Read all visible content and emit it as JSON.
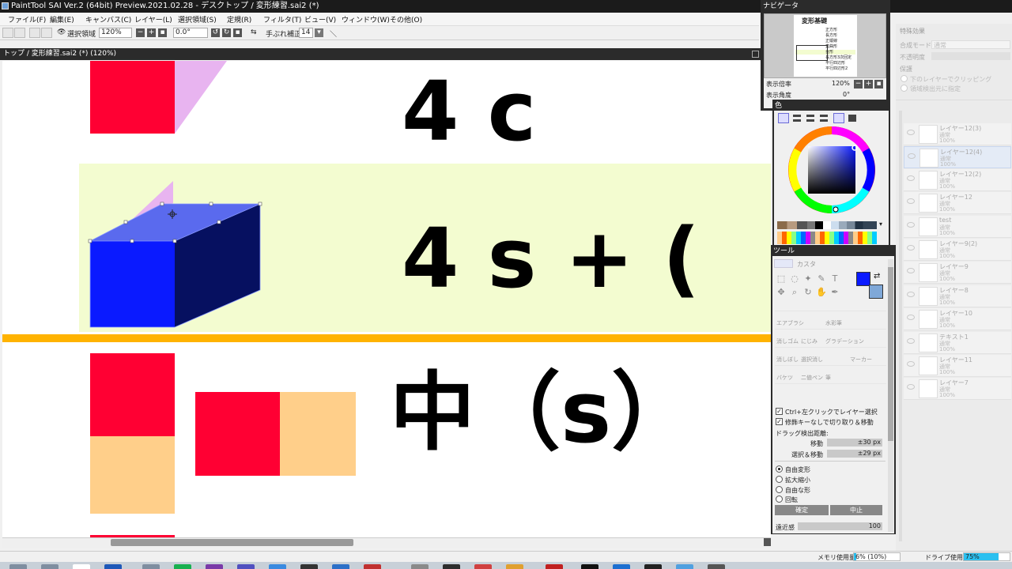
{
  "window": {
    "title": "PaintTool SAI Ver.2 (64bit) Preview.2021.02.28 - デスクトップ / 変形練習.sai2 (*)"
  },
  "menu": [
    "ファイル(F)",
    "編集(E)",
    "キャンバス(C)",
    "レイヤー(L)",
    "選択領域(S)",
    "定規(R)",
    "フィルタ(T)",
    "ビュー(V)",
    "ウィンドウ(W)",
    "その他(O)"
  ],
  "toolbar": {
    "selection_label": "選択領域",
    "zoom": "120%",
    "angle": "0.0°",
    "stabilizer_label": "手ぶれ補正",
    "stabilizer_value": "14"
  },
  "canvas": {
    "tab_title": "トップ / 変形練習.sai2 (*) (120%)",
    "text_4c": "4 c",
    "text_4s": "4 s + (",
    "text_naka": "中（s）",
    "colors": {
      "red": "#ff0033",
      "pink": "#e8b4f0",
      "blue": "#0a1aff",
      "navy": "#061060",
      "selection_blue": "#5a6aee",
      "yellow_band": "#f3fcd0",
      "orange_line": "#ffb300",
      "peach": "#ffcf8a"
    }
  },
  "navigator": {
    "title": "ナビゲータ",
    "page_heading": "変形基礎",
    "rows": [
      "正方形",
      "長方形",
      "正縦線",
      "直曲形",
      "台形",
      "長方形3次回定",
      "平行四辺形",
      "平行四辺形2"
    ],
    "zoom_label": "表示倍率",
    "zoom_value": "120%",
    "angle_label": "表示角度",
    "angle_value": "0°"
  },
  "color_panel": {
    "title": "色",
    "foreground": "#0a1aff",
    "background": "#7fa8d8"
  },
  "tool_panel": {
    "title": "ツール",
    "custom_label": "カスタ",
    "tool_names": [
      "エアブラシ",
      "水彩筆",
      "消しゴム",
      "にじみ",
      "グラデーション",
      "消しぼし",
      "選択消し",
      "マーカー",
      "バケツ",
      "二値ペン",
      "筆"
    ],
    "ctrl_click": "Ctrl+左クリックでレイヤー選択",
    "no_modifier": "修飾キーなしで切り取り＆移動",
    "drag_distance": "ドラッグ検出距離:",
    "move_label": "移動",
    "move_value": "±30 px",
    "select_move_label": "選択＆移動",
    "select_move_value": "±29 px",
    "modes": [
      "自由変形",
      "拡大縮小",
      "自由な形",
      "回転"
    ],
    "confirm": "確定",
    "cancel": "中止",
    "perspective_label": "遠近感",
    "perspective_value": "100"
  },
  "effects_panel": {
    "title": "特殊効果",
    "blend_label": "合成モード",
    "blend_value": "通常",
    "opacity_label": "不透明度",
    "protect_label": "保護",
    "clip_label": "下のレイヤーでクリッピング",
    "select_source": "領域検出元に指定"
  },
  "layers": [
    {
      "name": "レイヤー12(3)",
      "mode": "通常",
      "opacity": "100%"
    },
    {
      "name": "レイヤー12(4)",
      "mode": "通常",
      "opacity": "100%"
    },
    {
      "name": "レイヤー12(2)",
      "mode": "通常",
      "opacity": "100%"
    },
    {
      "name": "レイヤー12",
      "mode": "通常",
      "opacity": "100%"
    },
    {
      "name": "test",
      "mode": "通常",
      "opacity": "100%"
    },
    {
      "name": "レイヤー9(2)",
      "mode": "通常",
      "opacity": "100%"
    },
    {
      "name": "レイヤー9",
      "mode": "通常",
      "opacity": "100%"
    },
    {
      "name": "レイヤー8",
      "mode": "通常",
      "opacity": "100%"
    },
    {
      "name": "レイヤー10",
      "mode": "通常",
      "opacity": "100%"
    },
    {
      "name": "テキスト1",
      "mode": "通常",
      "opacity": "100%"
    },
    {
      "name": "レイヤー11",
      "mode": "通常",
      "opacity": "100%"
    },
    {
      "name": "レイヤー7",
      "mode": "通常",
      "opacity": "100%"
    }
  ],
  "status": {
    "memory_label": "メモリ使用量",
    "memory_value": "6% (10%)",
    "drive_label": "ドライブ使用量",
    "drive_value": "75%",
    "memory_fraction": 0.06,
    "drive_fraction": 0.75
  }
}
